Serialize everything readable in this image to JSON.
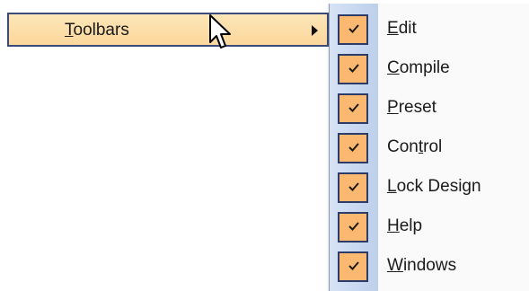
{
  "parent_item": {
    "label_prefix": "",
    "mnemonic": "T",
    "label_rest": "oolbars",
    "highlight_color": "#fbd79b",
    "border_color": "#3a4a7a",
    "arrow_icon": "chevron-right-icon"
  },
  "submenu": {
    "gutter_color": "#c7d7f0",
    "check_color": "#fbb870",
    "items": [
      {
        "pre": "",
        "mnemonic": "E",
        "post": "dit",
        "checked": true
      },
      {
        "pre": "",
        "mnemonic": "C",
        "post": "ompile",
        "checked": true
      },
      {
        "pre": "",
        "mnemonic": "P",
        "post": "reset",
        "checked": true
      },
      {
        "pre": "Con",
        "mnemonic": "t",
        "post": "rol",
        "checked": true
      },
      {
        "pre": "",
        "mnemonic": "L",
        "post": "ock Design",
        "checked": true
      },
      {
        "pre": "",
        "mnemonic": "H",
        "post": "elp",
        "checked": true
      },
      {
        "pre": "",
        "mnemonic": "W",
        "post": "indows",
        "checked": true
      }
    ]
  },
  "cursor": {
    "icon": "pointer-cursor-icon"
  }
}
